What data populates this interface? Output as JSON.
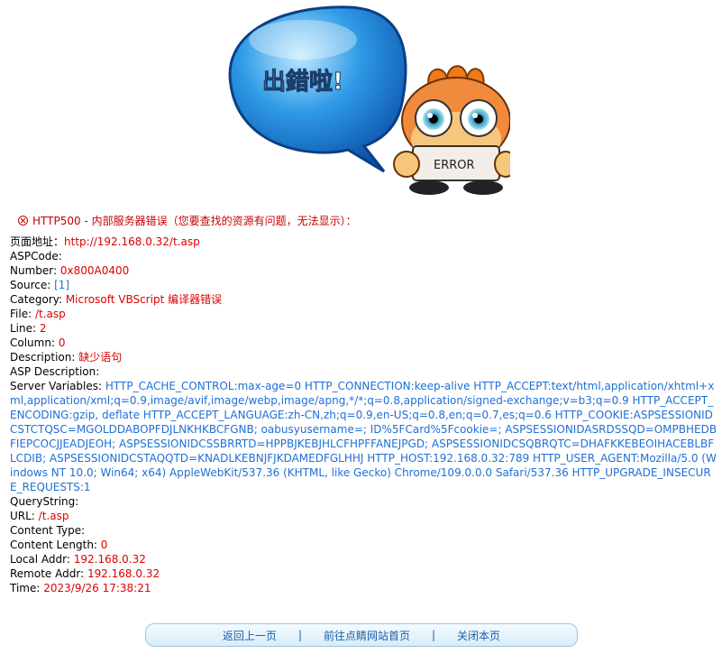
{
  "hero": {
    "bubble_text": "出錯啦!",
    "sign_text": "ERROR"
  },
  "error_title": "HTTP500 - 内部服务器错误（您要查找的资源有问题，无法显示）：",
  "fields": {
    "page_url_label": "页面地址：",
    "page_url": "http://192.168.0.32/t.asp",
    "aspcode_label": "ASPCode:",
    "number_label": "Number: ",
    "number": "0x800A0400",
    "source_label": "Source: ",
    "source": "[1]",
    "category_label": "Category: ",
    "category": "Microsoft VBScript 编译器错误",
    "file_label": "File: ",
    "file": "/t.asp",
    "line_label": "Line: ",
    "line": "2",
    "column_label": "Column: ",
    "column": "0",
    "description_label": "Description: ",
    "description": "缺少语句",
    "asp_description_label": "ASP Description:",
    "server_variables_label": "Server Variables: ",
    "server_variables": "HTTP_CACHE_CONTROL:max-age=0 HTTP_CONNECTION:keep-alive HTTP_ACCEPT:text/html,application/xhtml+xml,application/xml;q=0.9,image/avif,image/webp,image/apng,*/*;q=0.8,application/signed-exchange;v=b3;q=0.9 HTTP_ACCEPT_ENCODING:gzip, deflate HTTP_ACCEPT_LANGUAGE:zh-CN,zh;q=0.9,en-US;q=0.8,en;q=0.7,es;q=0.6 HTTP_COOKIE:ASPSESSIONIDCSTCTQSC=MGOLDDABOPFDJLNKHKBCFGNB; oabusyusername=; ID%5FCard%5Fcookie=; ASPSESSIONIDASRDSSQD=OMPBHEDBFIEPCOCJJEADJEOH; ASPSESSIONIDCSSBRRTD=HPPBJKEBJHLCFHPFFANEJPGD; ASPSESSIONIDCSQBRQTC=DHAFKKEBEOIHACEBLBFLCDIB; ASPSESSIONIDCSTAQQTD=KNADLKEBNJFJKDAMEDFGLHHJ HTTP_HOST:192.168.0.32:789 HTTP_USER_AGENT:Mozilla/5.0 (Windows NT 10.0; Win64; x64) AppleWebKit/537.36 (KHTML, like Gecko) Chrome/109.0.0.0 Safari/537.36 HTTP_UPGRADE_INSECURE_REQUESTS:1",
    "querystring_label": "QueryString:",
    "url_label": "URL: ",
    "url": "/t.asp",
    "content_type_label": "Content Type:",
    "content_length_label": "Content Length: ",
    "content_length": "0",
    "local_addr_label": "Local Addr: ",
    "local_addr": "192.168.0.32",
    "remote_addr_label": "Remote Addr: ",
    "remote_addr": "192.168.0.32",
    "time_label": "Time: ",
    "time": "2023/9/26 17:38:21"
  },
  "footer": {
    "back_label": "返回上一页",
    "home_label": "前往点睛网站首页",
    "close_label": "关闭本页",
    "separator": "|"
  },
  "colors": {
    "error_red": "#dd0000",
    "value_blue": "#1f6fd6",
    "link_blue": "#1a5fa8"
  }
}
